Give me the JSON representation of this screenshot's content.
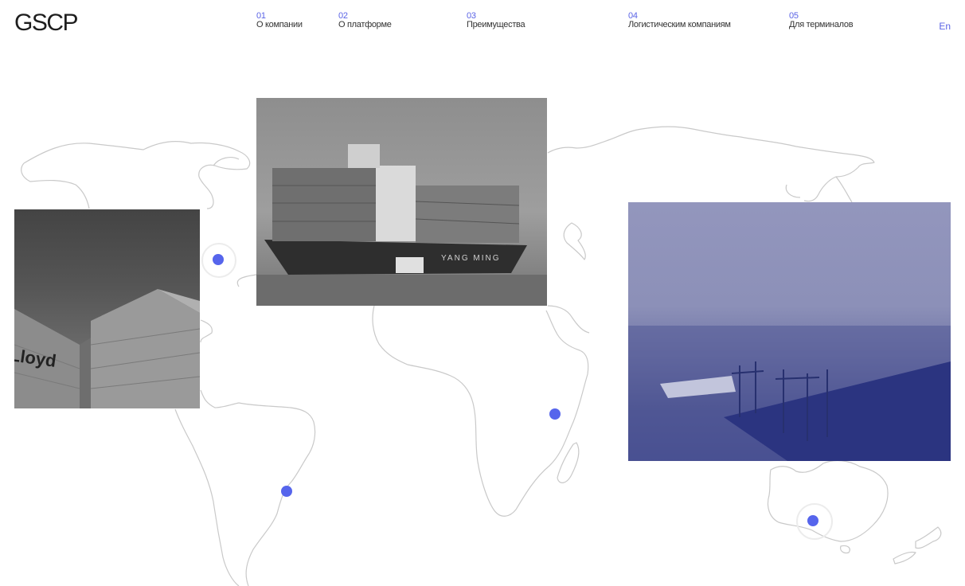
{
  "header": {
    "logo": "GSCP",
    "nav": [
      {
        "num": "01",
        "label": "О компании"
      },
      {
        "num": "02",
        "label": "О платформе"
      },
      {
        "num": "03",
        "label": "Преимущества"
      },
      {
        "num": "04",
        "label": "Логистическим компаниям"
      },
      {
        "num": "05",
        "label": "Для терминалов"
      }
    ],
    "lang": "En"
  },
  "photos": {
    "containers_brand_text": "Lloyd",
    "ship_brand_text": "YANG MING"
  },
  "colors": {
    "accent": "#5665ec",
    "map_outline": "#c9c9c9"
  }
}
